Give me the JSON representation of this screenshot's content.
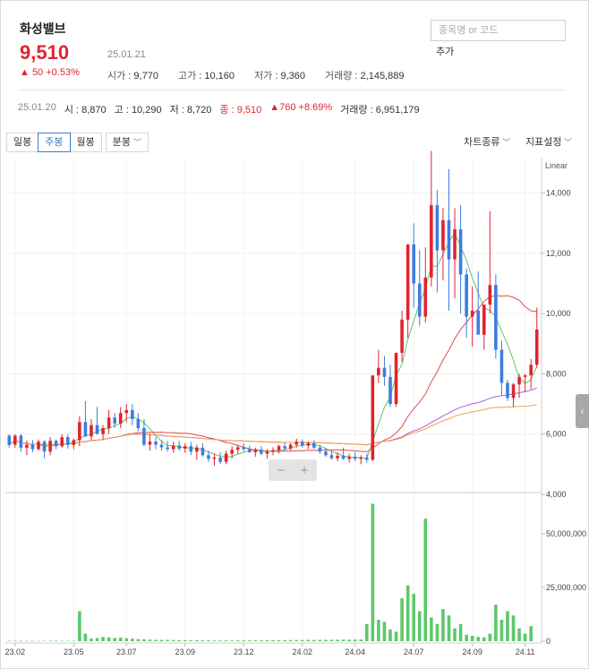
{
  "stock": {
    "name": "화성밸브",
    "price": "9,510",
    "change": "▲ 50 +0.53%",
    "date": "25.01.21",
    "open_label": "시가",
    "open": "9,770",
    "high_label": "고가",
    "high": "10,160",
    "low_label": "저가",
    "low": "9,360",
    "volume_label": "거래량",
    "volume": "2,145,889"
  },
  "search": {
    "placeholder": "종목명 or 코드",
    "add_label": "추가"
  },
  "prev_bar": {
    "date": "25.01.20",
    "open": "시 : 8,870",
    "high": "고 : 10,290",
    "low": "저 : 8,720",
    "close": "종 : 9,510",
    "change": "▲760 +8.69%",
    "volume": "거래량 : 6,951,179"
  },
  "toolbar": {
    "tabs": [
      "일봉",
      "주봉",
      "월봉",
      "분봉"
    ],
    "active_tab": "주봉",
    "chart_type_label": "차트종류",
    "indicator_label": "지표설정",
    "scale_label": "Linear",
    "zoom_out": "−",
    "zoom_in": "+"
  },
  "colors": {
    "up": "#e0242f",
    "down": "#3d7de0",
    "volume": "#5cc86a",
    "ma5": "#5cc86a",
    "ma20": "#e24b4b",
    "ma60": "#b35ed6",
    "ma120": "#f0a04a"
  },
  "chart_data": {
    "type": "candlestick",
    "ylim": [
      4000,
      15000
    ],
    "yticks": [
      4000,
      6000,
      8000,
      10000,
      12000,
      14000
    ],
    "volume_ylim": [
      0,
      65000000
    ],
    "volume_ticks": [
      0,
      25000000,
      50000000
    ],
    "xtick_labels": [
      "23.02",
      "23.05",
      "23.07",
      "23.09",
      "23.12",
      "24.02",
      "24.04",
      "24.07",
      "24.09",
      "24.11"
    ],
    "ohlc": [
      [
        5950,
        5990,
        5550,
        5640
      ],
      [
        5650,
        6000,
        5550,
        5950
      ],
      [
        5950,
        6000,
        5420,
        5550
      ],
      [
        5550,
        5780,
        5300,
        5650
      ],
      [
        5650,
        5800,
        5400,
        5500
      ],
      [
        5500,
        5820,
        5450,
        5750
      ],
      [
        5750,
        5800,
        5200,
        5420
      ],
      [
        5420,
        5900,
        5300,
        5780
      ],
      [
        5780,
        5820,
        5500,
        5600
      ],
      [
        5600,
        6000,
        5550,
        5900
      ],
      [
        5900,
        6000,
        5520,
        5640
      ],
      [
        5640,
        5850,
        5500,
        5800
      ],
      [
        5800,
        6600,
        5600,
        6400
      ],
      [
        6400,
        7100,
        6200,
        5920
      ],
      [
        5920,
        6500,
        5800,
        6300
      ],
      [
        6300,
        6900,
        6100,
        6000
      ],
      [
        6000,
        6300,
        5800,
        6200
      ],
      [
        6200,
        6800,
        6000,
        6550
      ],
      [
        6550,
        6700,
        6200,
        6350
      ],
      [
        6350,
        6900,
        6200,
        6700
      ],
      [
        6700,
        7000,
        6400,
        6800
      ],
      [
        6800,
        7000,
        6300,
        6500
      ],
      [
        6500,
        6700,
        6100,
        6200
      ],
      [
        6200,
        6500,
        5600,
        5650
      ],
      [
        5650,
        6000,
        5450,
        5750
      ],
      [
        5750,
        5900,
        5500,
        5650
      ],
      [
        5650,
        5800,
        5450,
        5560
      ],
      [
        5560,
        5780,
        5420,
        5500
      ],
      [
        5500,
        5750,
        5380,
        5620
      ],
      [
        5620,
        5780,
        5450,
        5520
      ],
      [
        5520,
        5700,
        5380,
        5600
      ],
      [
        5600,
        5750,
        5300,
        5420
      ],
      [
        5420,
        5650,
        5150,
        5550
      ],
      [
        5550,
        5700,
        5250,
        5300
      ],
      [
        5300,
        5450,
        5080,
        5180
      ],
      [
        5180,
        5350,
        4950,
        5220
      ],
      [
        5220,
        5400,
        5000,
        5080
      ],
      [
        5080,
        5450,
        5000,
        5350
      ],
      [
        5350,
        5600,
        5200,
        5480
      ],
      [
        5480,
        5640,
        5350,
        5560
      ],
      [
        5560,
        5700,
        5420,
        5500
      ],
      [
        5500,
        5620,
        5380,
        5400
      ],
      [
        5400,
        5550,
        5250,
        5480
      ],
      [
        5480,
        5600,
        5300,
        5350
      ],
      [
        5350,
        5500,
        5180,
        5420
      ],
      [
        5420,
        5560,
        5300,
        5470
      ],
      [
        5470,
        5650,
        5350,
        5600
      ],
      [
        5600,
        5720,
        5450,
        5520
      ],
      [
        5520,
        5700,
        5450,
        5650
      ],
      [
        5650,
        5850,
        5550,
        5750
      ],
      [
        5750,
        5820,
        5550,
        5620
      ],
      [
        5620,
        5760,
        5500,
        5700
      ],
      [
        5700,
        5800,
        5500,
        5550
      ],
      [
        5550,
        5650,
        5350,
        5420
      ],
      [
        5420,
        5550,
        5250,
        5300
      ],
      [
        5300,
        5450,
        5150,
        5200
      ],
      [
        5200,
        5400,
        5100,
        5280
      ],
      [
        5280,
        5550,
        5150,
        5180
      ],
      [
        5180,
        5350,
        5050,
        5250
      ],
      [
        5250,
        5400,
        5100,
        5180
      ],
      [
        5180,
        5300,
        5000,
        5220
      ],
      [
        5220,
        5350,
        5050,
        5150
      ],
      [
        5150,
        7500,
        5100,
        7950
      ],
      [
        7950,
        8800,
        7700,
        8200
      ],
      [
        8200,
        8600,
        7600,
        7900
      ],
      [
        7900,
        8300,
        6900,
        7000
      ],
      [
        7000,
        8600,
        6900,
        8700
      ],
      [
        8700,
        10100,
        8400,
        9800
      ],
      [
        9800,
        11500,
        9200,
        12300
      ],
      [
        12300,
        13000,
        10200,
        11000
      ],
      [
        11000,
        12100,
        9600,
        9900
      ],
      [
        9900,
        12200,
        9700,
        11200
      ],
      [
        11200,
        15400,
        10900,
        13600
      ],
      [
        13600,
        14100,
        10700,
        12100
      ],
      [
        12100,
        13500,
        11100,
        13100
      ],
      [
        13100,
        14800,
        10100,
        11800
      ],
      [
        11800,
        13500,
        10500,
        12800
      ],
      [
        12800,
        13600,
        10000,
        11300
      ],
      [
        11300,
        11500,
        9200,
        9900
      ],
      [
        9900,
        10900,
        8900,
        10100
      ],
      [
        10100,
        11400,
        9400,
        9300
      ],
      [
        9300,
        10200,
        8800,
        10300
      ],
      [
        10300,
        13400,
        10000,
        10950
      ],
      [
        10950,
        11300,
        8500,
        8800
      ],
      [
        8800,
        9100,
        7300,
        7700
      ],
      [
        7700,
        7800,
        7100,
        7200
      ],
      [
        7200,
        7700,
        6900,
        7650
      ],
      [
        7650,
        8000,
        7200,
        7900
      ],
      [
        7900,
        8000,
        7400,
        7950
      ],
      [
        7950,
        8500,
        7500,
        8300
      ],
      [
        8300,
        10200,
        8200,
        9470
      ]
    ],
    "volume": [
      200000,
      180000,
      190000,
      170000,
      160000,
      190000,
      210000,
      220000,
      200000,
      190000,
      210000,
      220000,
      14000000,
      3500000,
      1200000,
      1500000,
      2000000,
      1800000,
      1500000,
      1700000,
      1400000,
      1200000,
      1000000,
      900000,
      700000,
      600000,
      650000,
      600000,
      550000,
      500000,
      520000,
      480000,
      450000,
      420000,
      400000,
      380000,
      360000,
      350000,
      340000,
      360000,
      380000,
      400000,
      420000,
      440000,
      460000,
      480000,
      500000,
      520000,
      540000,
      560000,
      580000,
      600000,
      620000,
      640000,
      660000,
      680000,
      700000,
      720000,
      740000,
      760000,
      780000,
      8000000,
      64000000,
      10000000,
      9000000,
      5500000,
      4500000,
      20000000,
      26000000,
      22000000,
      14000000,
      57000000,
      11000000,
      8000000,
      15000000,
      12000000,
      6000000,
      8000000,
      3000000,
      2500000,
      2000000,
      1800000,
      3500000,
      17000000,
      10000000,
      14000000,
      12000000,
      6000000,
      3500000,
      7000000
    ]
  }
}
